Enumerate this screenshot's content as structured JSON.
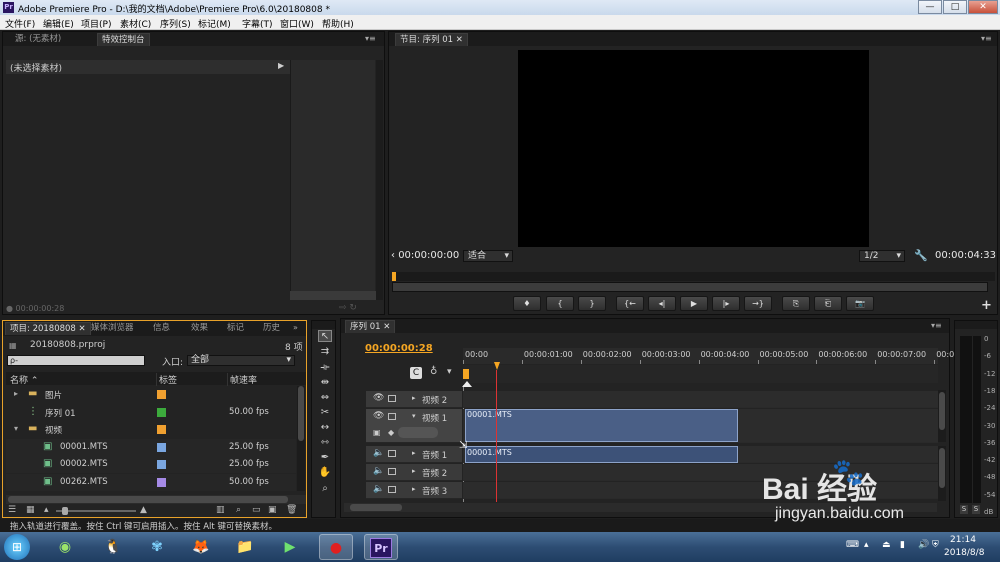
{
  "window": {
    "title": "Adobe Premiere Pro - D:\\我的文档\\Adobe\\Premiere Pro\\6.0\\20180808 *",
    "logo_text": "Pr",
    "minimize": "—",
    "maximize": "□",
    "close": "✕"
  },
  "menu": [
    "文件(F)",
    "编辑(E)",
    "项目(P)",
    "素材(C)",
    "序列(S)",
    "标记(M)",
    "字幕(T)",
    "窗口(W)",
    "帮助(H)"
  ],
  "source_panel": {
    "tab_source": "源: (无素材)",
    "tab_effect_controls": "特效控制台",
    "no_clip": "(未选择素材)",
    "timecode": "00:00:00:28"
  },
  "program_monitor": {
    "tab": "节目: 序列 01",
    "timecode_current": "00:00:00:00",
    "fit_label": "适合",
    "resolution": "1/2",
    "timecode_duration": "00:00:04:33",
    "buttons": [
      "♦",
      "{",
      "}",
      "{←",
      "◂|",
      "▶",
      "|▸",
      "→}",
      "⎘",
      "⎗",
      "📷"
    ],
    "add": "+"
  },
  "project_panel": {
    "tabs": [
      "项目: 20180808",
      "媒体浏览器",
      "信息",
      "效果",
      "标记",
      "历史"
    ],
    "file": "20180808.prproj",
    "item_count": "8 项",
    "entry_label": "入口:",
    "entry_value": "全部",
    "search_placeholder": "ρ-",
    "columns": [
      "名称",
      "标签",
      "帧速率"
    ],
    "items": [
      {
        "name": "图片",
        "icon": "folder-icon",
        "label_color": "#f0a030",
        "fps": "",
        "indent": 0,
        "expander": "▸"
      },
      {
        "name": "序列 01",
        "icon": "sequence-icon",
        "label_color": "#3caa3c",
        "fps": "50.00 fps",
        "indent": 0,
        "expander": ""
      },
      {
        "name": "视频",
        "icon": "folder-icon",
        "label_color": "#f0a030",
        "fps": "",
        "indent": 0,
        "expander": "▾"
      },
      {
        "name": "00001.MTS",
        "icon": "clip-icon",
        "label_color": "#7aa6e0",
        "fps": "25.00 fps",
        "indent": 1,
        "expander": ""
      },
      {
        "name": "00002.MTS",
        "icon": "clip-icon",
        "label_color": "#7aa6e0",
        "fps": "25.00 fps",
        "indent": 1,
        "expander": ""
      },
      {
        "name": "00262.MTS",
        "icon": "clip-icon",
        "label_color": "#a58ae6",
        "fps": "50.00 fps",
        "indent": 1,
        "expander": ""
      }
    ]
  },
  "timeline": {
    "tab": "序列 01",
    "timecode": "00:00:00:28",
    "ruler": [
      "00:00",
      "00:00:01:00",
      "00:00:02:00",
      "00:00:03:00",
      "00:00:04:00",
      "00:00:05:00",
      "00:00:06:00",
      "00:00:07:00",
      "00:00:0"
    ],
    "tracks": [
      {
        "name": "视频 2",
        "kind": "video",
        "expander": "▸"
      },
      {
        "name": "视频 1",
        "kind": "video",
        "expander": "▾"
      },
      {
        "name": "音频 1",
        "kind": "audio",
        "expander": "▸"
      },
      {
        "name": "音频 2",
        "kind": "audio",
        "expander": "▸"
      },
      {
        "name": "音频 3",
        "kind": "audio",
        "expander": "▸"
      }
    ],
    "video_clip": "00001.MTS",
    "audio_clip": "00001.MTS"
  },
  "audio_meter": {
    "labels": [
      "0",
      "-6",
      "-12",
      "-18",
      "-24",
      "-30",
      "-36",
      "-42",
      "-48",
      "-54",
      "dB"
    ],
    "solo": "S"
  },
  "status_bar": "拖入轨道进行覆盖。按住 Ctrl 键可启用插入。按住 Alt 键可替换素材。",
  "taskbar": {
    "clock_time": "21:14",
    "clock_date": "2018/8/8",
    "apps": [
      "windows-start-icon",
      "360-browser-icon",
      "qq-icon",
      "media-player-icon",
      "firefox-icon",
      "file-explorer-icon",
      "video-editor-icon",
      "screen-recorder-icon",
      "premiere-icon"
    ]
  },
  "watermark": {
    "brand": "Bai  经验",
    "url": "jingyan.baidu.com"
  }
}
